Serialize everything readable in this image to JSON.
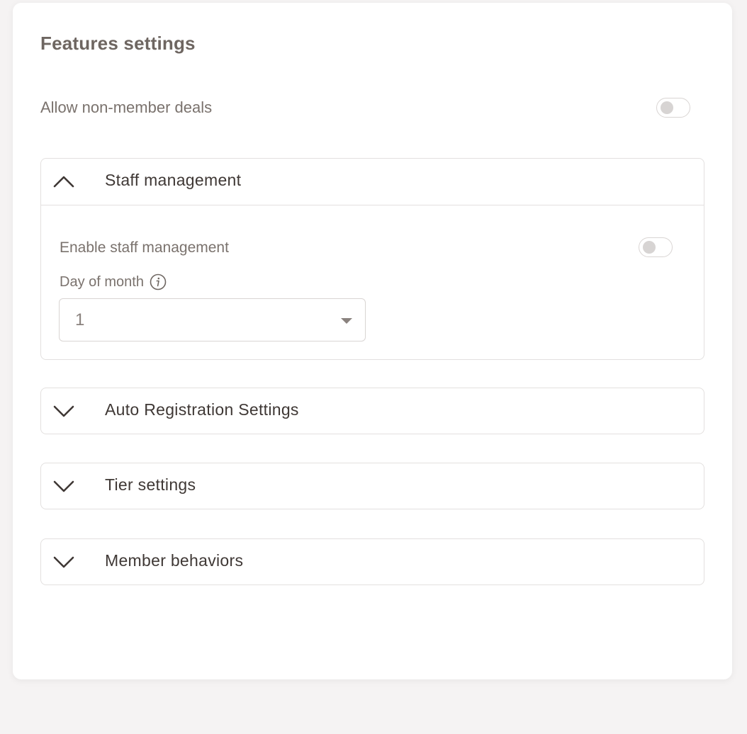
{
  "card": {
    "title": "Features settings"
  },
  "non_member_deals": {
    "label": "Allow non-member deals",
    "enabled": false
  },
  "staff_management": {
    "title": "Staff management",
    "expanded": true,
    "enable_label": "Enable staff management",
    "enabled": false,
    "day_label": "Day of month",
    "day_value": "1"
  },
  "sections": [
    {
      "title": "Auto Registration Settings",
      "expanded": false
    },
    {
      "title": "Tier settings",
      "expanded": false
    },
    {
      "title": "Member behaviors",
      "expanded": false
    }
  ],
  "icons": {
    "expanded": "chevron-up-icon",
    "collapsed": "chevron-down-icon",
    "info": "info-icon",
    "dropdown": "caret-down-icon"
  },
  "colors": {
    "title": "#6e6661",
    "text": "#3f3835",
    "muted": "#7a726d",
    "border": "#e3e0df",
    "background": "#f5f3f3"
  }
}
